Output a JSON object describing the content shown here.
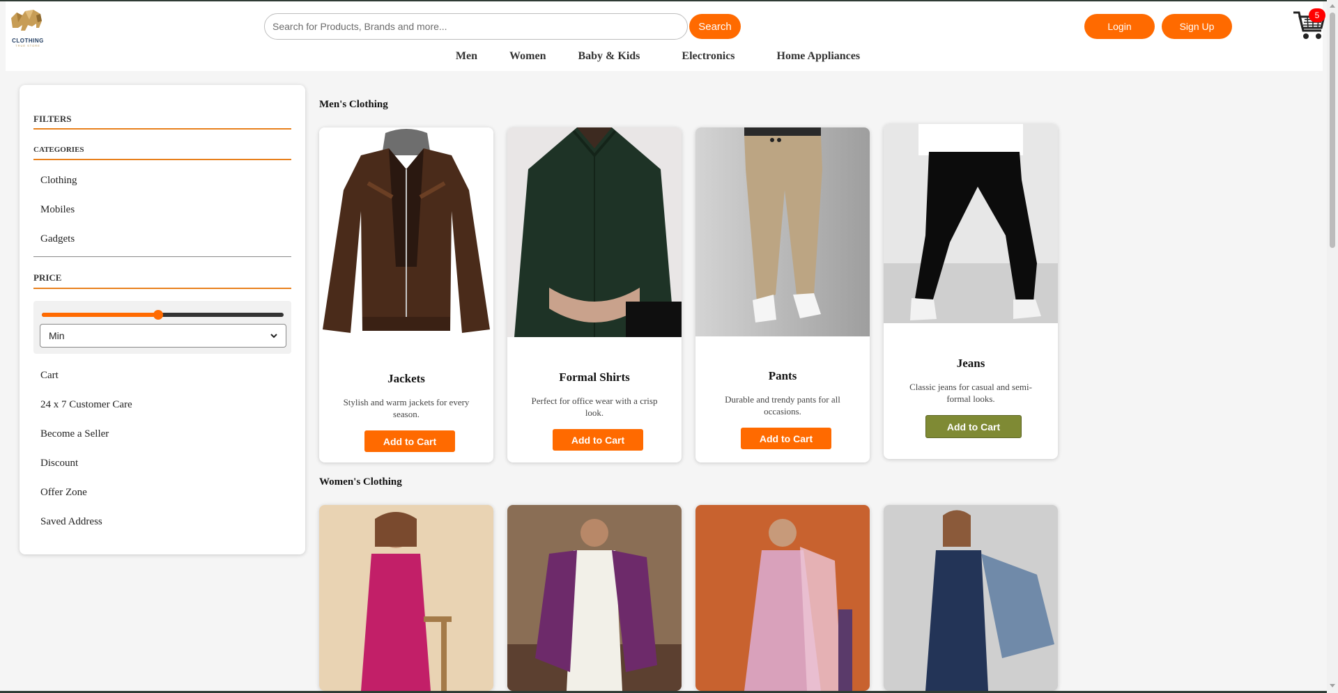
{
  "brand": {
    "name": "CLOTHING",
    "tagline": "TRUE STORE"
  },
  "header": {
    "search_placeholder": "Search for Products, Brands and more...",
    "search_label": "Search",
    "login_label": "Login",
    "signup_label": "Sign Up",
    "cart_count": "5"
  },
  "nav": [
    "Men",
    "Women",
    "Baby & Kids",
    "Electronics",
    "Home Appliances"
  ],
  "sidebar": {
    "filters_heading": "FILTERS",
    "categories_heading": "CATEGORIES",
    "categories": [
      "Clothing",
      "Mobiles",
      "Gadgets"
    ],
    "price_heading": "PRICE",
    "price_slider_fraction": 0.48,
    "price_select": "Min",
    "links": [
      "Cart",
      "24 x 7 Customer Care",
      "Become a Seller",
      "Discount",
      "Offer Zone",
      "Saved Address"
    ]
  },
  "sections": {
    "men": {
      "title": "Men's Clothing",
      "products": [
        {
          "name": "Jackets",
          "desc": "Stylish and warm jackets for every season.",
          "button": "Add to Cart"
        },
        {
          "name": "Formal Shirts",
          "desc": "Perfect for office wear with a crisp look.",
          "button": "Add to Cart"
        },
        {
          "name": "Pants",
          "desc": "Durable and trendy pants for all occasions.",
          "button": "Add to Cart"
        },
        {
          "name": "Jeans",
          "desc": "Classic jeans for casual and semi-formal looks.",
          "button": "Add to Cart"
        }
      ]
    },
    "women": {
      "title": "Women's Clothing"
    }
  },
  "colors": {
    "accent": "#ff6a00",
    "active_button": "#7f8a34",
    "rule": "#e8801c",
    "badge": "#ff0000"
  }
}
